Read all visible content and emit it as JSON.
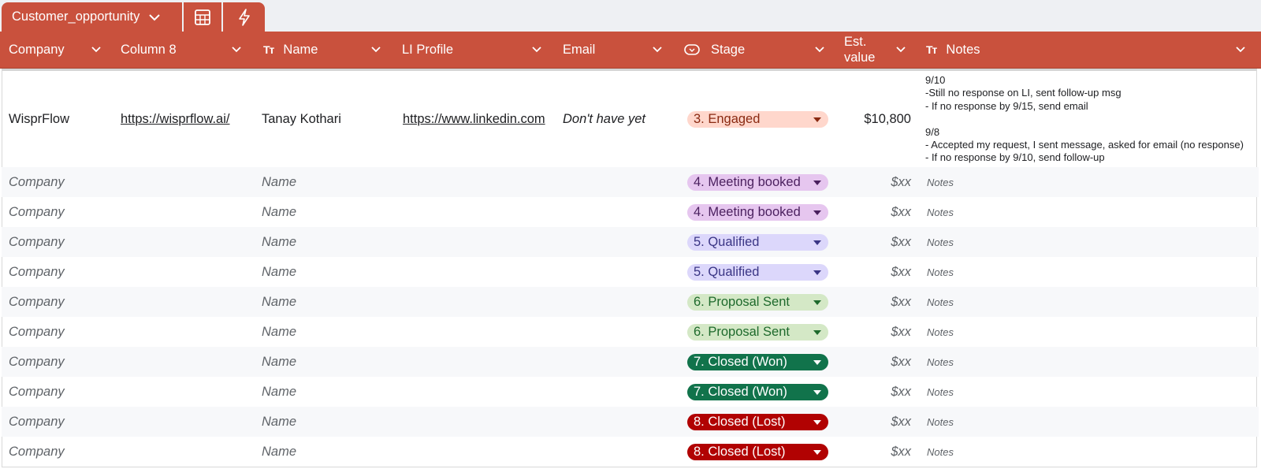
{
  "sheet_tab": {
    "name": "Customer_opportunity"
  },
  "colors": {
    "header_bg": "#c9513d",
    "tab_bg": "#c9513d"
  },
  "columns": [
    {
      "label": "Company"
    },
    {
      "label": "Column 8"
    },
    {
      "label": "Name",
      "type_icon": "Tт"
    },
    {
      "label": "LI Profile"
    },
    {
      "label": "Email"
    },
    {
      "label": "Stage",
      "type_icon": "dropdown-chip-icon"
    },
    {
      "label_line1": "Est.",
      "label_line2": "value"
    },
    {
      "label": "Notes",
      "type_icon": "Tт"
    }
  ],
  "first_row": {
    "company": "WisprFlow",
    "column8": "https://wisprflow.ai/",
    "name": "Tanay Kothari",
    "li_profile": "https://www.linkedin.com",
    "email": "Don't have yet",
    "stage": "3. Engaged",
    "est_value": "$10,800",
    "notes": "9/10\n-Still no response on LI, sent follow-up msg\n- If no response by 9/15, send email\n\n9/8\n- Accepted my request, I sent message, asked for email (no response)\n- If no response by 9/10, send follow-up"
  },
  "placeholders": {
    "company": "Company",
    "name": "Name",
    "est_value": "$xx",
    "notes": "Notes"
  },
  "rows": [
    {
      "stage": "4. Meeting booked",
      "bg": "#e6c6ef",
      "fg": "#4a1f5e",
      "caret": "#4a1f5e"
    },
    {
      "stage": "4. Meeting booked",
      "bg": "#e6c6ef",
      "fg": "#4a1f5e",
      "caret": "#4a1f5e"
    },
    {
      "stage": "5. Qualified",
      "bg": "#dcd7fb",
      "fg": "#3a3585",
      "caret": "#3a3585"
    },
    {
      "stage": "5. Qualified",
      "bg": "#dcd7fb",
      "fg": "#3a3585",
      "caret": "#3a3585"
    },
    {
      "stage": "6. Proposal Sent",
      "bg": "#d4e8c6",
      "fg": "#1e6a2c",
      "caret": "#1e6a2c"
    },
    {
      "stage": "6. Proposal Sent",
      "bg": "#d4e8c6",
      "fg": "#1e6a2c",
      "caret": "#1e6a2c"
    },
    {
      "stage": "7. Closed (Won)",
      "bg": "#11734b",
      "fg": "#ffffff",
      "caret": "#ffffff"
    },
    {
      "stage": "7. Closed (Won)",
      "bg": "#11734b",
      "fg": "#ffffff",
      "caret": "#ffffff"
    },
    {
      "stage": "8. Closed (Lost)",
      "bg": "#b10202",
      "fg": "#ffffff",
      "caret": "#ffffff"
    },
    {
      "stage": "8. Closed (Lost)",
      "bg": "#b10202",
      "fg": "#ffffff",
      "caret": "#ffffff"
    }
  ],
  "engaged_chip": {
    "bg": "#ffd7cc",
    "fg": "#8a2a12",
    "caret": "#8a2a12"
  }
}
